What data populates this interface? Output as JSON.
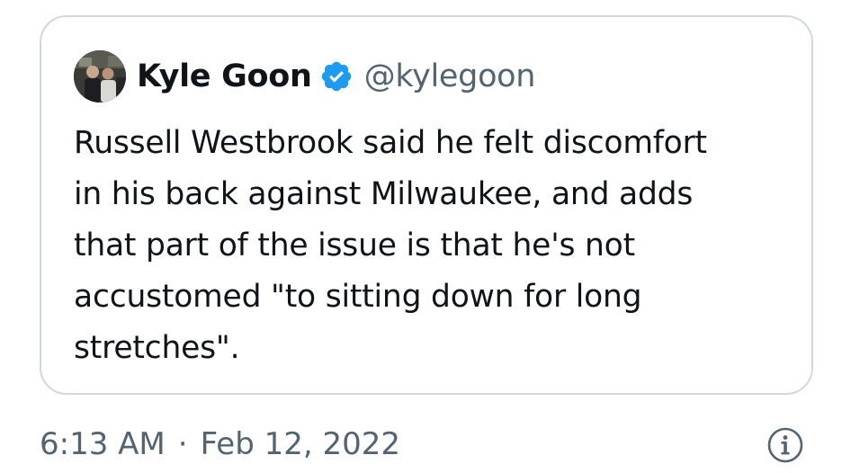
{
  "quoted_tweet": {
    "author": {
      "display_name": "Kyle Goon",
      "handle": "@kylegoon",
      "avatar_icon": "profile-photo",
      "verified_icon": "verified-badge-icon",
      "verified_color": "#1d9bf0"
    },
    "text_lines": [
      "Russell Westbrook said he felt discomfort",
      "in his back against Milwaukee, and adds",
      "that part of the issue is that he's not",
      "accustomed \"to sitting down for long",
      "stretches\"."
    ]
  },
  "meta": {
    "time": "6:13 AM",
    "separator": "·",
    "date": "Feb 12, 2022",
    "info_icon": "info-circle-icon"
  },
  "colors": {
    "text_primary": "#0f1419",
    "text_secondary": "#536471",
    "card_border": "#cfd9de"
  }
}
